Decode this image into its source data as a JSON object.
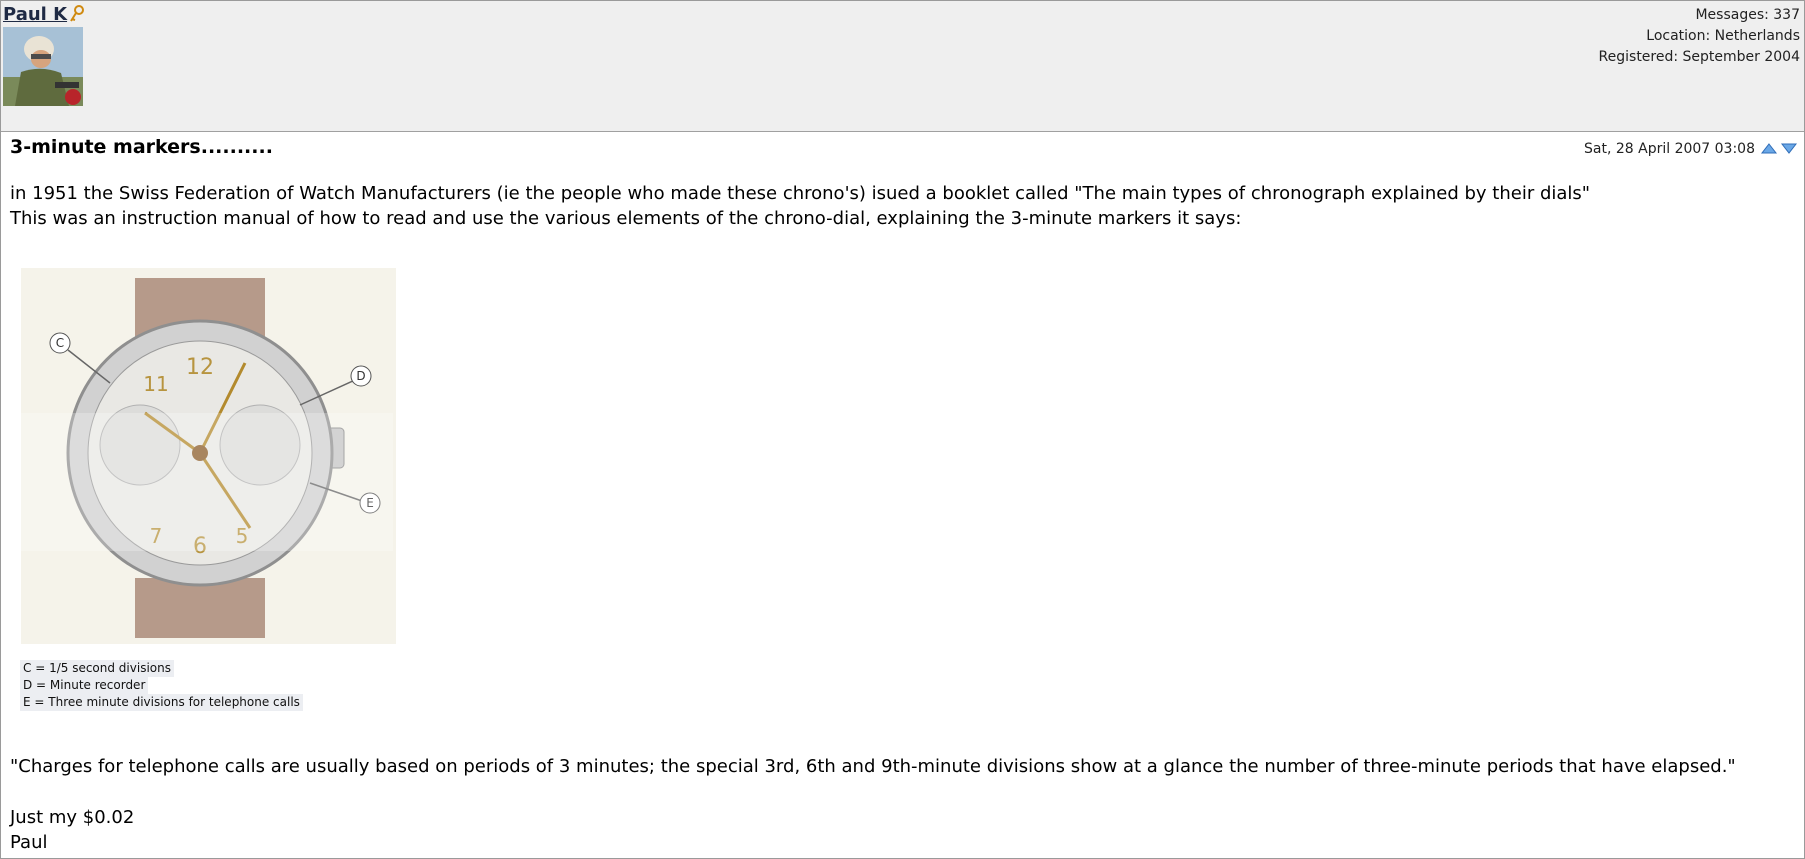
{
  "author": {
    "name": "Paul K"
  },
  "meta": {
    "messages": "Messages: 337",
    "location": "Location: Netherlands",
    "registered": "Registered: September 2004"
  },
  "post": {
    "title": "3-minute markers..........",
    "date": "Sat, 28 April 2007 03:08",
    "paragraph1": "in 1951 the Swiss Federation of Watch Manufacturers (ie the people who made these chrono's) isued a booklet called \"The main types of chronograph explained by their dials\"",
    "paragraph2": "This was an instruction manual of how to read and use the various elements of the chrono-dial, explaining the 3-minute markers it says:",
    "image_labels": {
      "c": "C",
      "d": "D",
      "e": "E"
    },
    "caption": [
      "C = 1/5 second divisions",
      "D = Minute recorder",
      "E = Three minute divisions for telephone calls"
    ],
    "quote": "\"Charges for telephone calls are usually based on periods of 3 minutes; the special 3rd, 6th and 9th-minute divisions show at a glance the number of three-minute periods that have elapsed.\"",
    "closing1": "Just my $0.02",
    "closing2": "Paul"
  },
  "icons": {
    "key": "key-icon",
    "up": "arrow-up-icon",
    "down": "arrow-down-icon"
  },
  "colors": {
    "header_bg": "#efefef",
    "link": "#1f2a44",
    "arrow": "#3b7fd0"
  }
}
